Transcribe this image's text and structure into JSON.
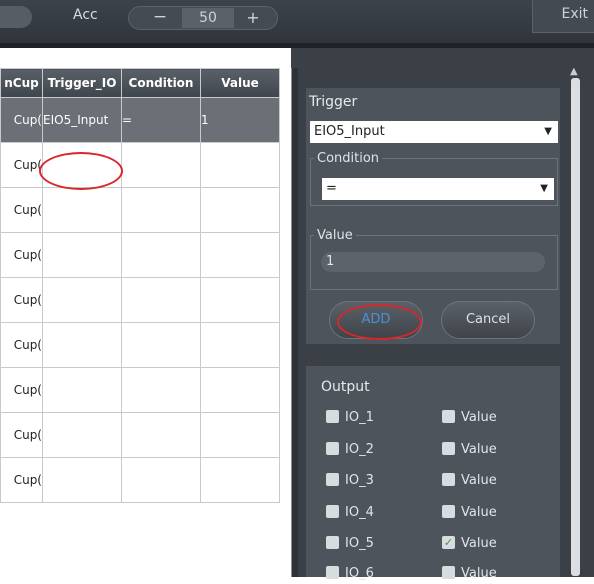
{
  "toolbar": {
    "acc_label": "Acc",
    "acc_minus": "−",
    "acc_value": "50",
    "acc_plus": "+",
    "exit_label": "Exit"
  },
  "table": {
    "headers": [
      "nCup",
      "Trigger_IO",
      "Condition",
      "Value"
    ],
    "rows": [
      [
        "Cup(",
        "EIO5_Input",
        "=",
        "1"
      ],
      [
        "Cup(",
        "",
        "",
        ""
      ],
      [
        "Cup(",
        "",
        "",
        ""
      ],
      [
        "Cup(",
        "",
        "",
        ""
      ],
      [
        "Cup(",
        "",
        "",
        ""
      ],
      [
        "Cup(",
        "",
        "",
        ""
      ],
      [
        "Cup(",
        "",
        "",
        ""
      ],
      [
        "Cup(",
        "",
        "",
        ""
      ],
      [
        "Cup(",
        "",
        "",
        ""
      ]
    ]
  },
  "trigger_panel": {
    "title": "Trigger",
    "trigger_value": "EIO5_Input",
    "condition_legend": "Condition",
    "condition_value": "=",
    "value_legend": "Value",
    "value_input": "1",
    "add_label": "ADD",
    "cancel_label": "Cancel"
  },
  "output_panel": {
    "title": "Output",
    "items": [
      {
        "io": "IO_1",
        "value_label": "Value",
        "value_checked": false
      },
      {
        "io": "IO_2",
        "value_label": "Value",
        "value_checked": false
      },
      {
        "io": "IO_3",
        "value_label": "Value",
        "value_checked": false
      },
      {
        "io": "IO_4",
        "value_label": "Value",
        "value_checked": false
      },
      {
        "io": "IO_5",
        "value_label": "Value",
        "value_checked": true
      },
      {
        "io": "IO_6",
        "value_label": "Value",
        "value_checked": false
      }
    ]
  },
  "colors": {
    "toolbar_bg": "#30353c",
    "panel_bg": "#3b4047",
    "group_bg": "#4e545b",
    "selected_row": "#6b7076",
    "highlight_red": "#d9262b",
    "add_text_blue": "#4f8ed6",
    "check_green": "#35a04a"
  }
}
